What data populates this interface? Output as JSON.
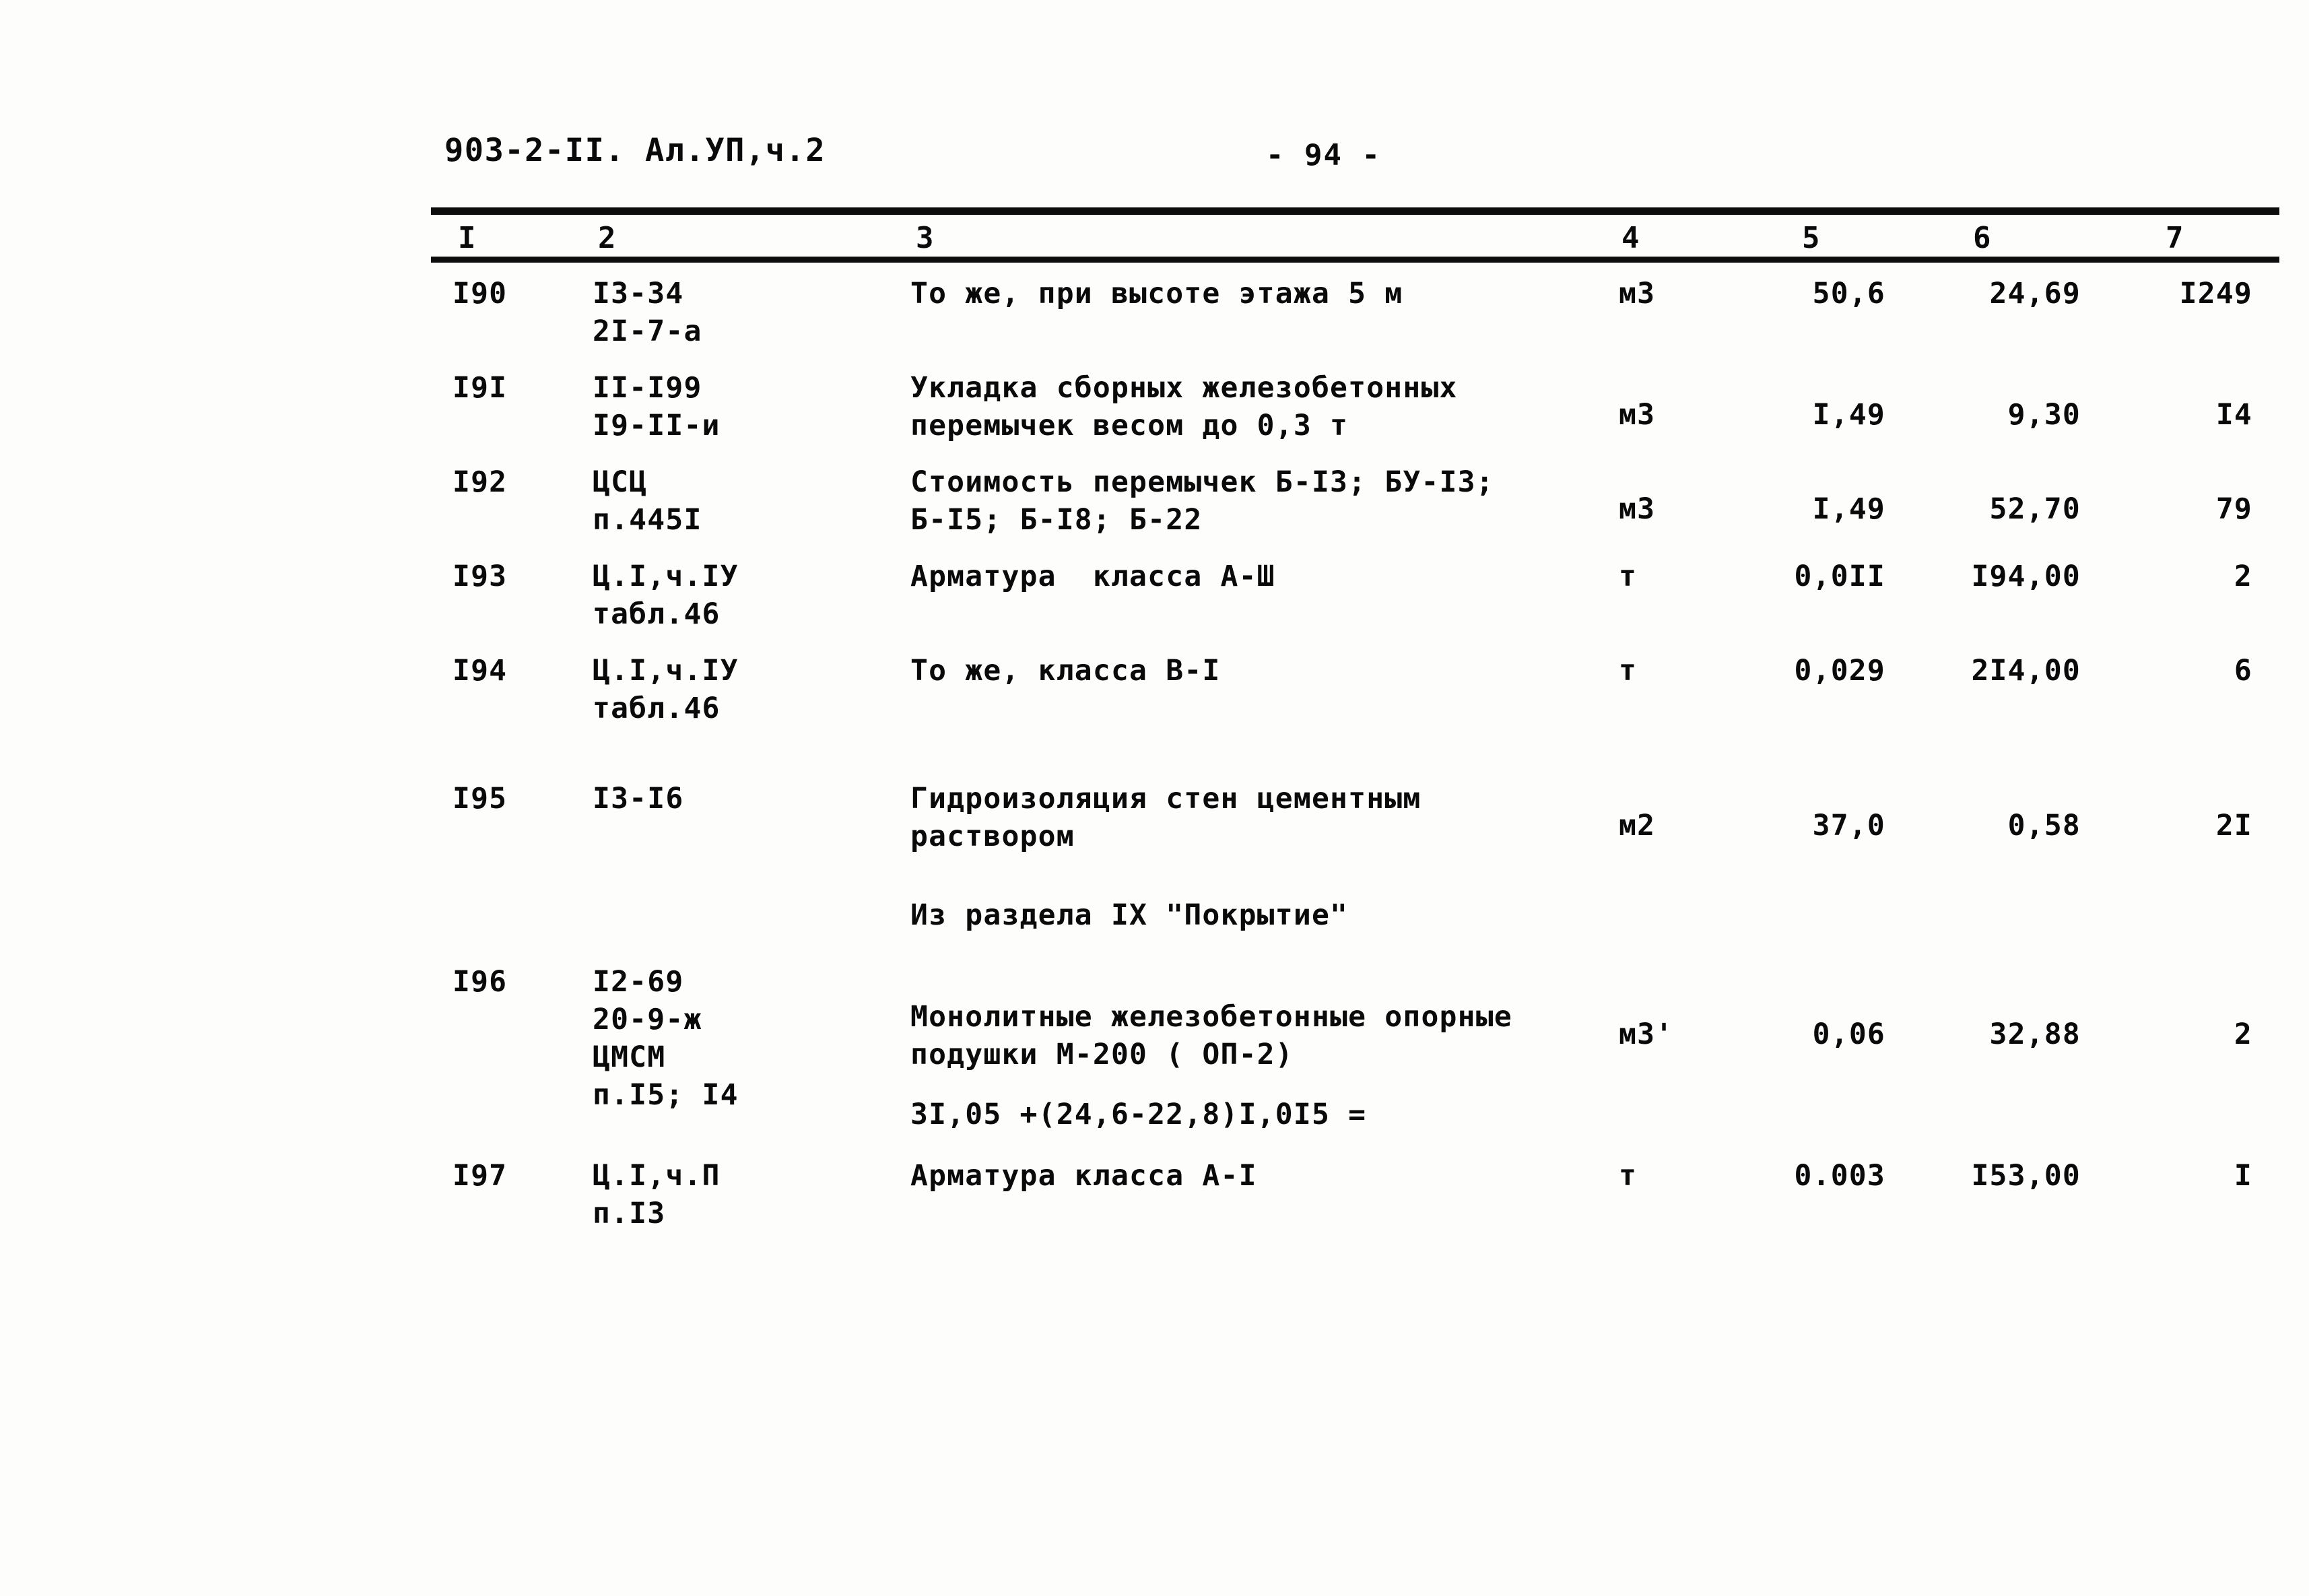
{
  "header": {
    "doc_code": "903-2-II. Ал.УП,ч.2",
    "page_label": "- 94 -"
  },
  "table": {
    "column_headers": [
      "I",
      "2",
      "3",
      "4",
      "5",
      "6",
      "7"
    ],
    "rows": [
      {
        "num": "I90",
        "code": "I3-34\n2I-7-а",
        "desc": "То же, при высоте этажа 5 м",
        "unit": "м3",
        "qty": "50,6",
        "price": "24,69",
        "total": "I249"
      },
      {
        "num": "I9I",
        "code": "II-I99\nI9-II-и",
        "desc": "Укладка сборных железобетонных\nперемычек весом до 0,3 т",
        "unit": "м3",
        "qty": "I,49",
        "price": "9,30",
        "total": "I4"
      },
      {
        "num": "I92",
        "code": "ЦСЦ\nп.445I",
        "desc": "Стоимость перемычек Б-I3; БУ-I3;\nБ-I5; Б-I8; Б-22",
        "unit": "м3",
        "qty": "I,49",
        "price": "52,70",
        "total": "79"
      },
      {
        "num": "I93",
        "code": "Ц.I,ч.IУ\nтабл.46",
        "desc": "Арматура  класса А-Ш",
        "unit": "т",
        "qty": "0,0II",
        "price": "I94,00",
        "total": "2"
      },
      {
        "num": "I94",
        "code": "Ц.I,ч.IУ\nтабл.46",
        "desc": "То же, класса В-I",
        "unit": "т",
        "qty": "0,029",
        "price": "2I4,00",
        "total": "6"
      },
      {
        "num": "I95",
        "code": "I3-I6",
        "desc": "Гидроизоляция стен цементным\nраствором",
        "unit": "м2",
        "qty": "37,0",
        "price": "0,58",
        "total": "2I"
      },
      {
        "num": "I96",
        "code": "I2-69\n20-9-ж\nЦМСМ\nп.I5; I4",
        "desc": "Монолитные железобетонные опорные\nподушки М-200 ( ОП-2)",
        "unit": "м3'",
        "qty": "0,06",
        "price": "32,88",
        "total": "2"
      },
      {
        "num": "I97",
        "code": "Ц.I,ч.П\nп.I3",
        "desc": "Арматура класса А-I",
        "unit": "т",
        "qty": "0.003",
        "price": "I53,00",
        "total": "I"
      }
    ],
    "section_note": "Из раздела IX \"Покрытие\"",
    "formula": "3I,05 +(24,6-22,8)I,0I5 ="
  }
}
